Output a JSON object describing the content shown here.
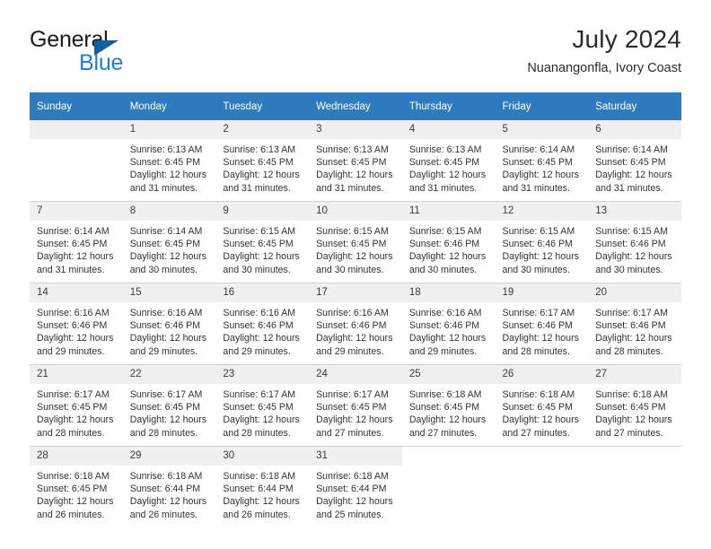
{
  "brand": {
    "name_part1": "General",
    "name_part2": "Blue",
    "logo_icon": "triangle-logo-icon"
  },
  "header": {
    "title": "July 2024",
    "subtitle": "Nuanangonfla, Ivory Coast"
  },
  "calendar": {
    "weekday_headers": [
      "Sunday",
      "Monday",
      "Tuesday",
      "Wednesday",
      "Thursday",
      "Friday",
      "Saturday"
    ],
    "accent_color": "#2e7cbf",
    "daynum_band_color": "#f0f0f0",
    "weeks": [
      [
        {
          "day": "",
          "blank": true,
          "sunrise": "",
          "sunset": "",
          "daylight_line1": "",
          "daylight_line2": ""
        },
        {
          "day": "1",
          "sunrise": "Sunrise: 6:13 AM",
          "sunset": "Sunset: 6:45 PM",
          "daylight_line1": "Daylight: 12 hours",
          "daylight_line2": "and 31 minutes."
        },
        {
          "day": "2",
          "sunrise": "Sunrise: 6:13 AM",
          "sunset": "Sunset: 6:45 PM",
          "daylight_line1": "Daylight: 12 hours",
          "daylight_line2": "and 31 minutes."
        },
        {
          "day": "3",
          "sunrise": "Sunrise: 6:13 AM",
          "sunset": "Sunset: 6:45 PM",
          "daylight_line1": "Daylight: 12 hours",
          "daylight_line2": "and 31 minutes."
        },
        {
          "day": "4",
          "sunrise": "Sunrise: 6:13 AM",
          "sunset": "Sunset: 6:45 PM",
          "daylight_line1": "Daylight: 12 hours",
          "daylight_line2": "and 31 minutes."
        },
        {
          "day": "5",
          "sunrise": "Sunrise: 6:14 AM",
          "sunset": "Sunset: 6:45 PM",
          "daylight_line1": "Daylight: 12 hours",
          "daylight_line2": "and 31 minutes."
        },
        {
          "day": "6",
          "sunrise": "Sunrise: 6:14 AM",
          "sunset": "Sunset: 6:45 PM",
          "daylight_line1": "Daylight: 12 hours",
          "daylight_line2": "and 31 minutes."
        }
      ],
      [
        {
          "day": "7",
          "sunrise": "Sunrise: 6:14 AM",
          "sunset": "Sunset: 6:45 PM",
          "daylight_line1": "Daylight: 12 hours",
          "daylight_line2": "and 31 minutes."
        },
        {
          "day": "8",
          "sunrise": "Sunrise: 6:14 AM",
          "sunset": "Sunset: 6:45 PM",
          "daylight_line1": "Daylight: 12 hours",
          "daylight_line2": "and 30 minutes."
        },
        {
          "day": "9",
          "sunrise": "Sunrise: 6:15 AM",
          "sunset": "Sunset: 6:45 PM",
          "daylight_line1": "Daylight: 12 hours",
          "daylight_line2": "and 30 minutes."
        },
        {
          "day": "10",
          "sunrise": "Sunrise: 6:15 AM",
          "sunset": "Sunset: 6:45 PM",
          "daylight_line1": "Daylight: 12 hours",
          "daylight_line2": "and 30 minutes."
        },
        {
          "day": "11",
          "sunrise": "Sunrise: 6:15 AM",
          "sunset": "Sunset: 6:46 PM",
          "daylight_line1": "Daylight: 12 hours",
          "daylight_line2": "and 30 minutes."
        },
        {
          "day": "12",
          "sunrise": "Sunrise: 6:15 AM",
          "sunset": "Sunset: 6:46 PM",
          "daylight_line1": "Daylight: 12 hours",
          "daylight_line2": "and 30 minutes."
        },
        {
          "day": "13",
          "sunrise": "Sunrise: 6:15 AM",
          "sunset": "Sunset: 6:46 PM",
          "daylight_line1": "Daylight: 12 hours",
          "daylight_line2": "and 30 minutes."
        }
      ],
      [
        {
          "day": "14",
          "sunrise": "Sunrise: 6:16 AM",
          "sunset": "Sunset: 6:46 PM",
          "daylight_line1": "Daylight: 12 hours",
          "daylight_line2": "and 29 minutes."
        },
        {
          "day": "15",
          "sunrise": "Sunrise: 6:16 AM",
          "sunset": "Sunset: 6:46 PM",
          "daylight_line1": "Daylight: 12 hours",
          "daylight_line2": "and 29 minutes."
        },
        {
          "day": "16",
          "sunrise": "Sunrise: 6:16 AM",
          "sunset": "Sunset: 6:46 PM",
          "daylight_line1": "Daylight: 12 hours",
          "daylight_line2": "and 29 minutes."
        },
        {
          "day": "17",
          "sunrise": "Sunrise: 6:16 AM",
          "sunset": "Sunset: 6:46 PM",
          "daylight_line1": "Daylight: 12 hours",
          "daylight_line2": "and 29 minutes."
        },
        {
          "day": "18",
          "sunrise": "Sunrise: 6:16 AM",
          "sunset": "Sunset: 6:46 PM",
          "daylight_line1": "Daylight: 12 hours",
          "daylight_line2": "and 29 minutes."
        },
        {
          "day": "19",
          "sunrise": "Sunrise: 6:17 AM",
          "sunset": "Sunset: 6:46 PM",
          "daylight_line1": "Daylight: 12 hours",
          "daylight_line2": "and 28 minutes."
        },
        {
          "day": "20",
          "sunrise": "Sunrise: 6:17 AM",
          "sunset": "Sunset: 6:46 PM",
          "daylight_line1": "Daylight: 12 hours",
          "daylight_line2": "and 28 minutes."
        }
      ],
      [
        {
          "day": "21",
          "sunrise": "Sunrise: 6:17 AM",
          "sunset": "Sunset: 6:45 PM",
          "daylight_line1": "Daylight: 12 hours",
          "daylight_line2": "and 28 minutes."
        },
        {
          "day": "22",
          "sunrise": "Sunrise: 6:17 AM",
          "sunset": "Sunset: 6:45 PM",
          "daylight_line1": "Daylight: 12 hours",
          "daylight_line2": "and 28 minutes."
        },
        {
          "day": "23",
          "sunrise": "Sunrise: 6:17 AM",
          "sunset": "Sunset: 6:45 PM",
          "daylight_line1": "Daylight: 12 hours",
          "daylight_line2": "and 28 minutes."
        },
        {
          "day": "24",
          "sunrise": "Sunrise: 6:17 AM",
          "sunset": "Sunset: 6:45 PM",
          "daylight_line1": "Daylight: 12 hours",
          "daylight_line2": "and 27 minutes."
        },
        {
          "day": "25",
          "sunrise": "Sunrise: 6:18 AM",
          "sunset": "Sunset: 6:45 PM",
          "daylight_line1": "Daylight: 12 hours",
          "daylight_line2": "and 27 minutes."
        },
        {
          "day": "26",
          "sunrise": "Sunrise: 6:18 AM",
          "sunset": "Sunset: 6:45 PM",
          "daylight_line1": "Daylight: 12 hours",
          "daylight_line2": "and 27 minutes."
        },
        {
          "day": "27",
          "sunrise": "Sunrise: 6:18 AM",
          "sunset": "Sunset: 6:45 PM",
          "daylight_line1": "Daylight: 12 hours",
          "daylight_line2": "and 27 minutes."
        }
      ],
      [
        {
          "day": "28",
          "sunrise": "Sunrise: 6:18 AM",
          "sunset": "Sunset: 6:45 PM",
          "daylight_line1": "Daylight: 12 hours",
          "daylight_line2": "and 26 minutes."
        },
        {
          "day": "29",
          "sunrise": "Sunrise: 6:18 AM",
          "sunset": "Sunset: 6:44 PM",
          "daylight_line1": "Daylight: 12 hours",
          "daylight_line2": "and 26 minutes."
        },
        {
          "day": "30",
          "sunrise": "Sunrise: 6:18 AM",
          "sunset": "Sunset: 6:44 PM",
          "daylight_line1": "Daylight: 12 hours",
          "daylight_line2": "and 26 minutes."
        },
        {
          "day": "31",
          "sunrise": "Sunrise: 6:18 AM",
          "sunset": "Sunset: 6:44 PM",
          "daylight_line1": "Daylight: 12 hours",
          "daylight_line2": "and 25 minutes."
        },
        {
          "day": "",
          "blank": true,
          "sunrise": "",
          "sunset": "",
          "daylight_line1": "",
          "daylight_line2": ""
        },
        {
          "day": "",
          "blank": true,
          "sunrise": "",
          "sunset": "",
          "daylight_line1": "",
          "daylight_line2": ""
        },
        {
          "day": "",
          "blank": true,
          "sunrise": "",
          "sunset": "",
          "daylight_line1": "",
          "daylight_line2": ""
        }
      ]
    ]
  }
}
